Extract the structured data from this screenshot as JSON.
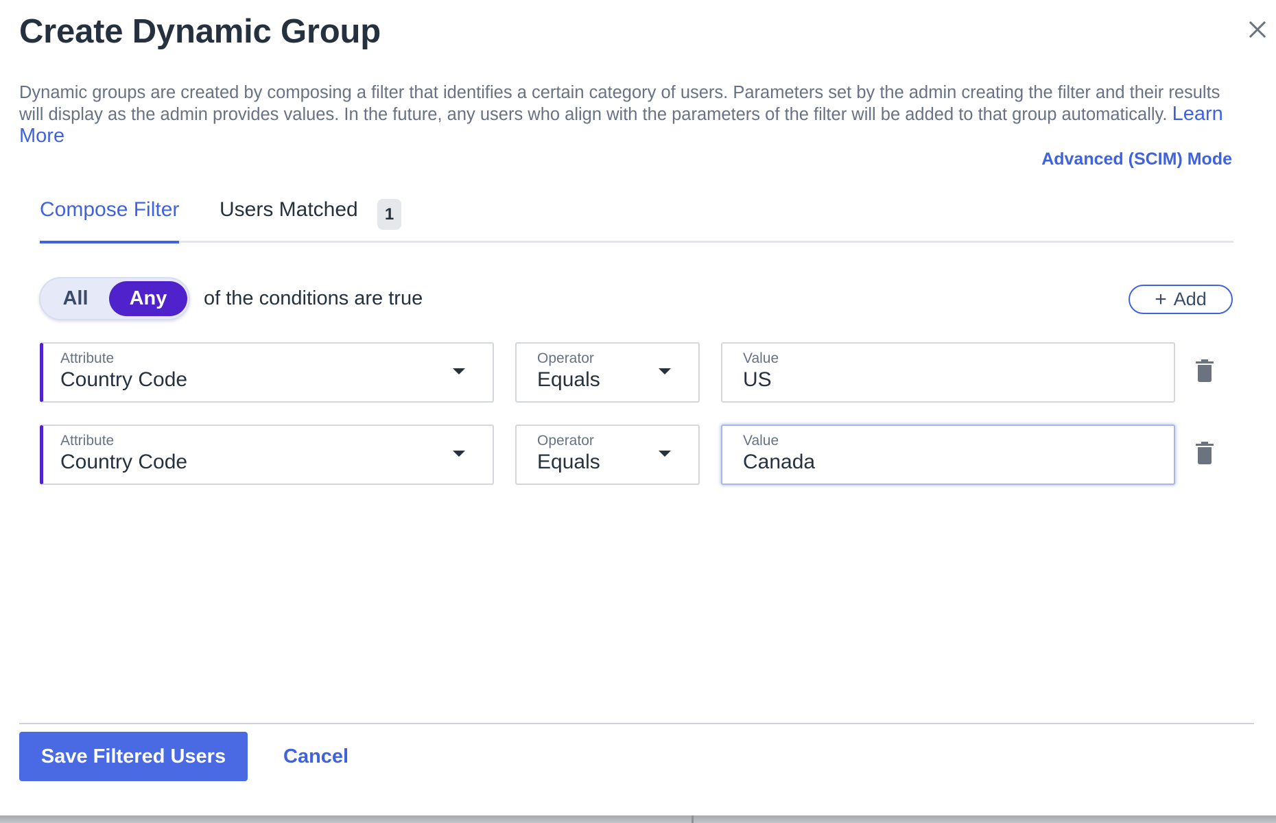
{
  "dialog": {
    "title": "Create Dynamic Group",
    "close_icon": "close-icon",
    "description": "Dynamic groups are created by composing a filter that identifies a certain category of users. Parameters set by the admin creating the filter and their results will display as the admin provides values. In the future, any users who align with the parameters of the filter will be added to that group automatically.",
    "learn_more": "Learn More",
    "advanced_mode": "Advanced (SCIM) Mode"
  },
  "tabs": [
    {
      "label": "Compose Filter",
      "active": true
    },
    {
      "label": "Users Matched",
      "badge": "1",
      "active": false
    }
  ],
  "match": {
    "options": [
      "All",
      "Any"
    ],
    "selected": "Any",
    "suffix": "of the conditions are true",
    "add_label": "Add",
    "add_icon": "plus-icon"
  },
  "conditions": [
    {
      "attribute_label": "Attribute",
      "attribute": "Country Code",
      "operator_label": "Operator",
      "operator": "Equals",
      "value_label": "Value",
      "value": "US",
      "delete_icon": "trash-icon"
    },
    {
      "attribute_label": "Attribute",
      "attribute": "Country Code",
      "operator_label": "Operator",
      "operator": "Equals",
      "value_label": "Value",
      "value": "Canada",
      "focused": true,
      "delete_icon": "trash-icon"
    }
  ],
  "footer": {
    "save_label": "Save Filtered Users",
    "cancel_label": "Cancel"
  },
  "colors": {
    "primary": "#4a6ae4",
    "link": "#3f63e0",
    "accent_purple": "#5022cc",
    "text_dark": "#26313f",
    "text_muted": "#677284"
  }
}
